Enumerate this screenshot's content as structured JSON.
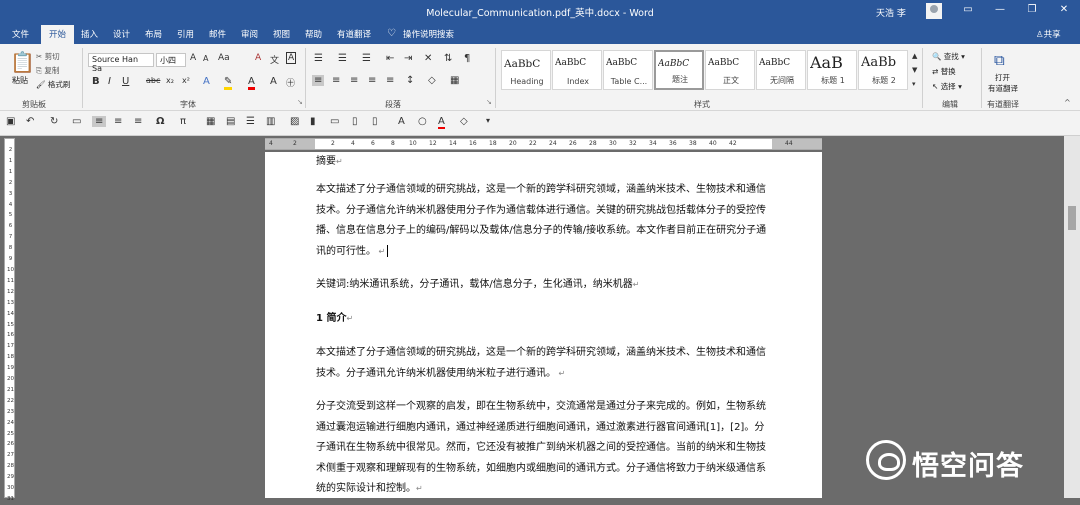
{
  "window": {
    "title": "Molecular_Communication.pdf_英中.docx - Word",
    "user": "天浩 李"
  },
  "tabs": [
    "文件",
    "开始",
    "插入",
    "设计",
    "布局",
    "引用",
    "邮件",
    "审阅",
    "视图",
    "帮助",
    "有道翻译"
  ],
  "tell_me": "操作说明搜索",
  "share": "共享",
  "clipboard": {
    "paste": "粘贴",
    "cut": "剪切",
    "copy": "复制",
    "painter": "格式刷",
    "group": "剪贴板"
  },
  "font": {
    "name": "Source Han Sa",
    "size": "小四",
    "group": "字体"
  },
  "paragraph": {
    "group": "段落"
  },
  "styles": {
    "group": "样式",
    "items": [
      {
        "preview": "AaBbC",
        "name": "Heading"
      },
      {
        "preview": "AaBbC",
        "name": "Index"
      },
      {
        "preview": "AaBbC",
        "name": "Table C..."
      },
      {
        "preview": "AaBbC",
        "name": "题注"
      },
      {
        "preview": "AaBbC",
        "name": "正文"
      },
      {
        "preview": "AaBbC",
        "name": "无间隔"
      },
      {
        "preview": "AaB",
        "name": "标题 1"
      },
      {
        "preview": "AaBb",
        "name": "标题 2"
      }
    ]
  },
  "editing": {
    "find": "查找",
    "replace": "替换",
    "select": "选择",
    "group": "编辑"
  },
  "youdao": {
    "open_line1": "打开",
    "open_line2": "有道翻译",
    "group": "有道翻译"
  },
  "ruler_marks": [
    "4",
    "2",
    "2",
    "4",
    "6",
    "8",
    "10",
    "12",
    "14",
    "16",
    "18",
    "20",
    "22",
    "24",
    "26",
    "28",
    "30",
    "32",
    "34",
    "36",
    "38",
    "40",
    "42",
    "44"
  ],
  "vruler_marks": [
    "2",
    "1",
    "1",
    "2",
    "3",
    "4",
    "5",
    "6",
    "7",
    "8",
    "9",
    "10",
    "11",
    "12",
    "13",
    "14",
    "15",
    "16",
    "17",
    "18",
    "19",
    "20",
    "21",
    "22",
    "23",
    "24",
    "25",
    "26",
    "27",
    "28",
    "29",
    "30",
    "31"
  ],
  "document": {
    "heading_abstract": "摘要",
    "abstract": "本文描述了分子通信领域的研究挑战，这是一个新的跨学科研究领域，涵盖纳米技术、生物技术和通信技术。分子通信允许纳米机器使用分子作为通信载体进行通信。关键的研究挑战包括载体分子的受控传播、信息在信息分子上的编码/解码以及载体/信息分子的传输/接收系统。本文作者目前正在研究分子通讯的可行性。",
    "keywords": "关键词:纳米通讯系统，分子通讯，载体/信息分子，生化通讯，纳米机器",
    "section_title": "1 简介",
    "intro1": "本文描述了分子通信领域的研究挑战，这是一个新的跨学科研究领域，涵盖纳米技术、生物技术和通信技术。分子通讯允许纳米机器使用纳米粒子进行通讯。",
    "intro2": "分子交流受到这样一个观察的启发，即在生物系统中，交流通常是通过分子来完成的。例如，生物系统通过囊泡运输进行细胞内通讯，通过神经递质进行细胞间通讯，通过激素进行器官间通讯[1]，[2]。分子通讯在生物系统中很常见。然而，它还没有被推广到纳米机器之间的受控通信。当前的纳米和生物技术侧重于观察和理解现有的生物系统，如细胞内或细胞间的通讯方式。分子通信将致力于纳米级通信系统的实际设计和控制。"
  },
  "watermark": {
    "text": "悟空问答"
  }
}
